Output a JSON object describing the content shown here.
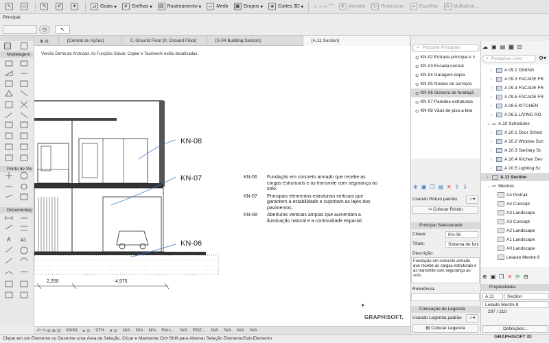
{
  "toolbar": {
    "items": [
      {
        "label": "Guias",
        "icon": "guides-icon"
      },
      {
        "label": "Grelhas",
        "icon": "grid-icon"
      },
      {
        "label": "Rastreamento",
        "icon": "trace-icon"
      },
      {
        "label": "Medir",
        "icon": "measure-icon"
      },
      {
        "label": "Grupos",
        "icon": "groups-icon"
      },
      {
        "label": "Cortes 3D",
        "icon": "cut-3d-icon"
      },
      {
        "label": "Arrastar",
        "icon": "drag-icon"
      },
      {
        "label": "Rotacionar",
        "icon": "rotate-icon"
      },
      {
        "label": "Espelhar",
        "icon": "mirror-icon"
      },
      {
        "label": "Multiplicar...",
        "icon": "multiply-icon"
      }
    ]
  },
  "infobox": {
    "title": "Principal:"
  },
  "tabs": [
    {
      "label": "[Central de Ações]"
    },
    {
      "label": "0. Ground Floor [0. Ground Floor]"
    },
    {
      "label": "[S-04 Building Section]"
    },
    {
      "label": "[A.11 Section]"
    }
  ],
  "toolbox": {
    "groups": [
      "Modelagem",
      "Ponto de Vis",
      "Documentaç"
    ]
  },
  "canvas": {
    "demo_notice": "Versão Demo do Archicad. As Funções Salvar, Copiar e Teamwork estão desativadas.",
    "labels": [
      "KN-08",
      "KN-07",
      "KN-06"
    ],
    "legend": [
      {
        "code": "KN-06",
        "text": "Fundação em concreto armado que recebe as cargas estruturais e as transmite com segurança ao solo."
      },
      {
        "code": "KN-07",
        "text": "Principais elementos estruturais verticais que garantem a estabilidade e suportam as lajes dos pavimentos."
      },
      {
        "code": "KN-08",
        "text": "Aberturas verticais amplas que aumentam a iluminação natural e a continuidade espacial."
      }
    ],
    "dimensions": [
      "2,250",
      "4,975"
    ],
    "brand": "GRAPHISOFT."
  },
  "bottombar": {
    "page": "43/43",
    "zoom": "97%",
    "na": "N/A",
    "pers": "Pers...",
    "enz": "ENZ..."
  },
  "statusbar": {
    "text": "Clique em um Elemento ou Desenhe uma Área de Seleção. Clicar e Mantenha Ctrl+Shift para Alternar Seleção Elemento/Sub-Elemento."
  },
  "keynote_panel": {
    "search_placeholder": "Procurar Principais",
    "items": [
      "KN-02 Entrada principal e c",
      "KN-03 Escada central",
      "KN-04 Garagem dupla",
      "KN-05 Núcleo de serviços",
      "KN-06 Sistema de fundaçã",
      "KN-07 Paredes estruturais",
      "KN-08 Vãos de piso a teto"
    ],
    "selected_index": 4,
    "label_mode": "Usando Rótulo padrão",
    "place_label_button": "Colocar Rótulo",
    "selected_section": "Principal Selecionado",
    "key_label": "Chave:",
    "key_value": "KN-06",
    "title_label": "Título:",
    "title_value": "Sistema de fund",
    "description_label": "Descrição:",
    "description_value": "Fundação em concreto armado que recebe as cargas estruturais e as transmite com segurança ao solo.",
    "reference_label": "Referência:",
    "legend_section": "Colocação da Legenda",
    "legend_mode": "Usando Legenda padrão",
    "place_legend_button": "Colocar Legenda"
  },
  "navigator": {
    "search_placeholder": "Pesquisar Livro",
    "items": [
      {
        "label": "A.09.2 DINING",
        "indent": 1,
        "type": "sheet"
      },
      {
        "label": "A.09.3 FACADE FR",
        "indent": 1,
        "type": "sheet"
      },
      {
        "label": "A.09.4 FACADE FR",
        "indent": 1,
        "type": "sheet"
      },
      {
        "label": "A.09.5 FACADE FR",
        "indent": 1,
        "type": "sheet"
      },
      {
        "label": "A.08.5 KITCHEN",
        "indent": 1,
        "type": "sheet"
      },
      {
        "label": "A.08.5 LIVING RO",
        "indent": 1,
        "type": "sheet"
      },
      {
        "label": "A.10 Schedules",
        "indent": 0,
        "type": "folder"
      },
      {
        "label": "A.10.1 Door Sched",
        "indent": 1,
        "type": "sheet"
      },
      {
        "label": "A.10.2 Window Sch",
        "indent": 1,
        "type": "sheet"
      },
      {
        "label": "A.10.3 Sanitary Sc",
        "indent": 1,
        "type": "sheet"
      },
      {
        "label": "A.10.4 Kitchen Dev",
        "indent": 1,
        "type": "sheet"
      },
      {
        "label": "A.10.5 Lighting Sc",
        "indent": 1,
        "type": "sheet"
      },
      {
        "label": "A.11 Section",
        "indent": 0,
        "type": "selected"
      },
      {
        "label": "Mestres",
        "indent": 0,
        "type": "folder"
      },
      {
        "label": "A4 Portrait",
        "indent": 1,
        "type": "master"
      },
      {
        "label": "A4 Concept",
        "indent": 1,
        "type": "master"
      },
      {
        "label": "A3 Landscape",
        "indent": 1,
        "type": "master"
      },
      {
        "label": "A3 Concept",
        "indent": 1,
        "type": "master"
      },
      {
        "label": "A2 Landscape",
        "indent": 1,
        "type": "master"
      },
      {
        "label": "A1 Landscape",
        "indent": 1,
        "type": "master"
      },
      {
        "label": "A0 Landscape",
        "indent": 1,
        "type": "master"
      },
      {
        "label": "Leiaute Mestre 8",
        "indent": 1,
        "type": "master"
      }
    ],
    "properties_title": "Propriedades",
    "prop_id": "A.11",
    "prop_name": "Section",
    "prop_master": "Leiaute Mestre 8",
    "prop_size": "297 / 210",
    "definitions_button": "Definições...",
    "footer": "GRAPHISOFT ID"
  }
}
